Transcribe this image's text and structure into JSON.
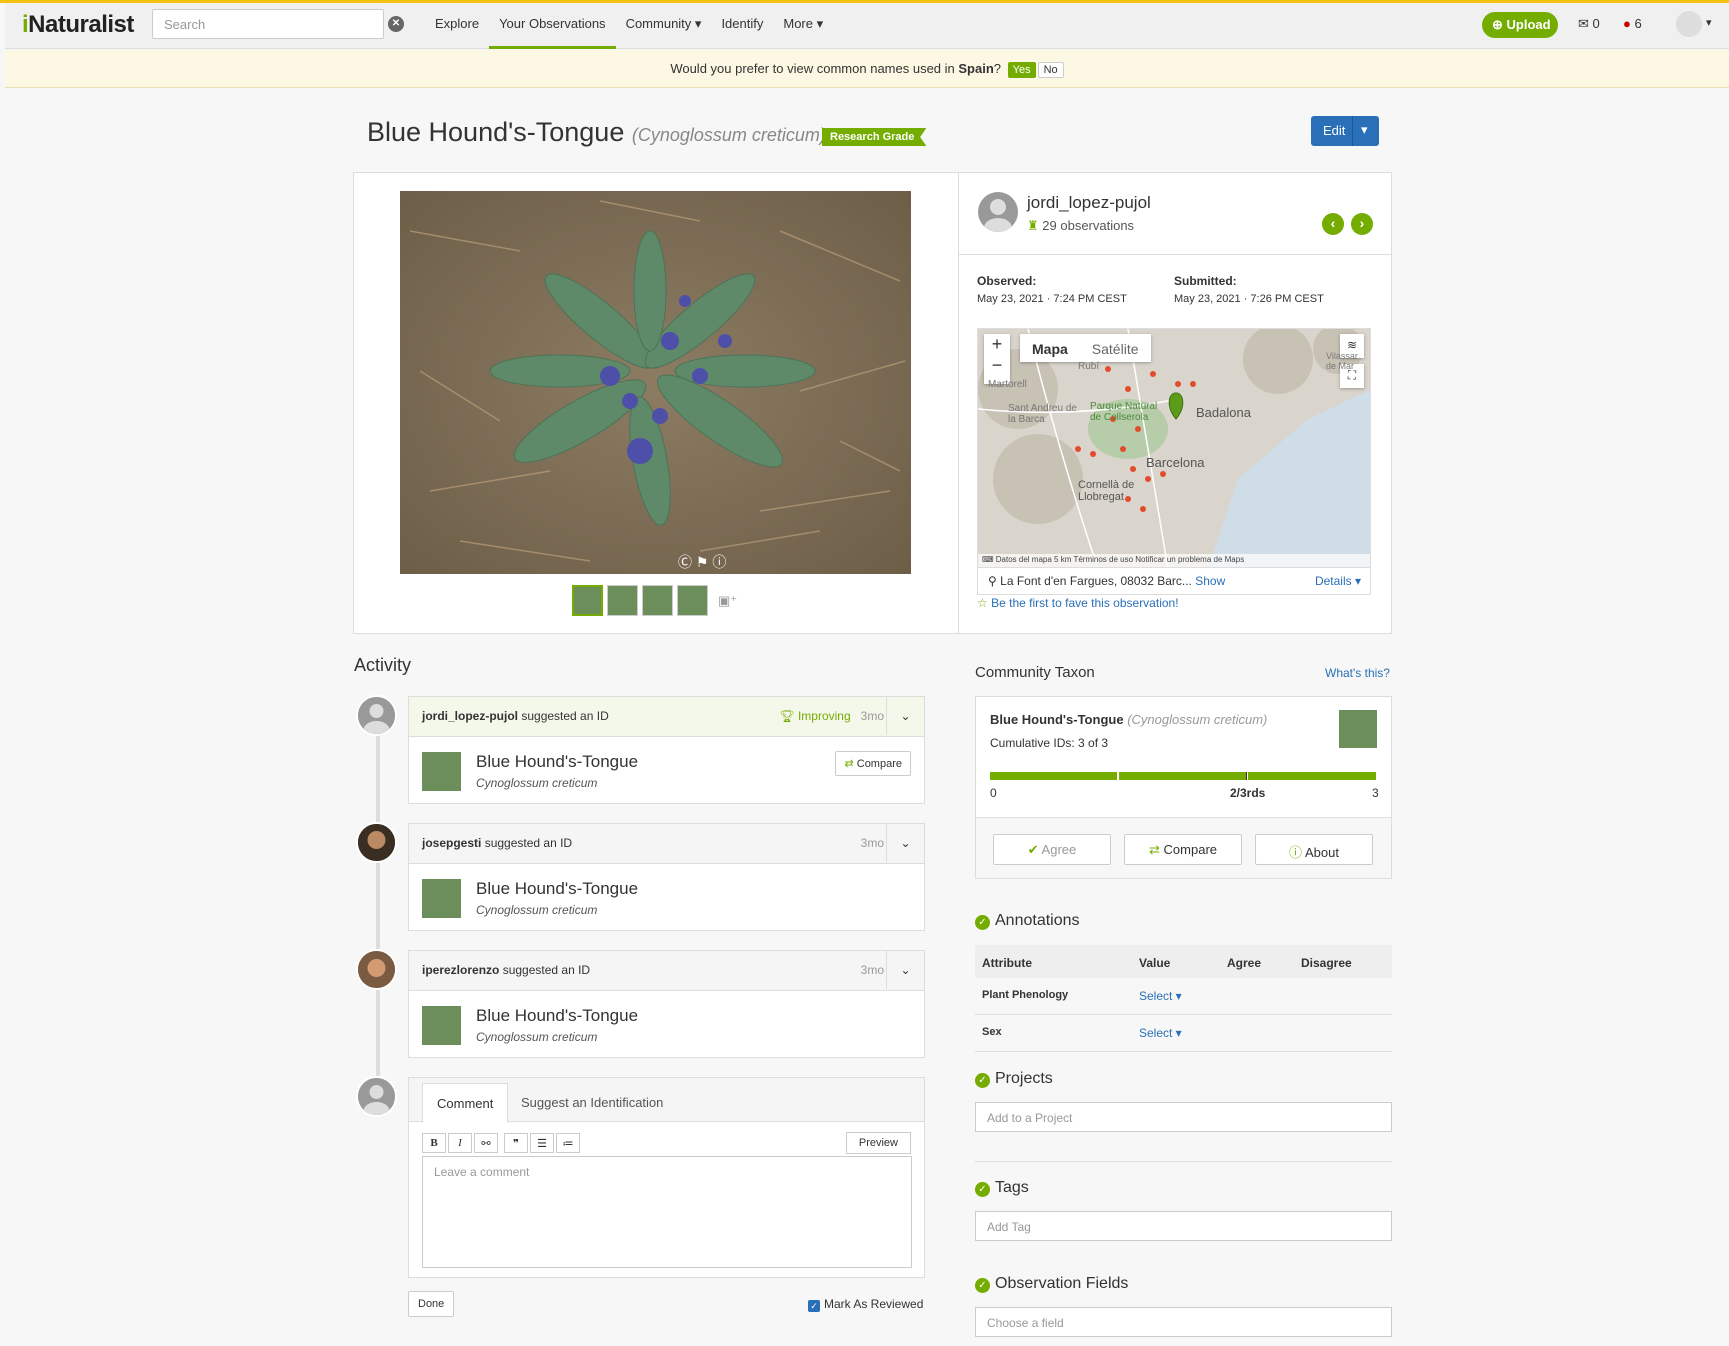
{
  "colors": {
    "brand": "#74ac00",
    "link": "#2a70b8",
    "banner_bg": "#fdf8e4"
  },
  "header": {
    "logo_prefix": "i",
    "logo_rest": "Naturalist",
    "search_placeholder": "Search",
    "nav": [
      {
        "label": "Explore",
        "active": false
      },
      {
        "label": "Your Observations",
        "active": true
      },
      {
        "label": "Community ▾",
        "active": false
      },
      {
        "label": "Identify",
        "active": false
      },
      {
        "label": "More ▾",
        "active": false
      }
    ],
    "upload_label": "Upload",
    "messages_count": "0",
    "notifications_count": "6"
  },
  "banner": {
    "text_before": "Would you prefer to view common names used in ",
    "place": "Spain",
    "text_after": "?",
    "yes": "Yes",
    "no": "No"
  },
  "observation": {
    "common_name": "Blue Hound's-Tongue",
    "sci_name": "Cynoglossum creticum",
    "quality_grade": "Research Grade",
    "edit_label": "Edit",
    "user": {
      "login": "jordi_lopez-pujol",
      "observations": "29 observations"
    },
    "observed_label": "Observed:",
    "observed_value": "May 23, 2021 · 7:24 PM CEST",
    "submitted_label": "Submitted:",
    "submitted_value": "May 23, 2021 · 7:26 PM CEST",
    "map": {
      "tab_map": "Mapa",
      "tab_sat": "Satélite",
      "cities": [
        "Badalona",
        "Barcelona",
        "Cornellà de Llobregat",
        "Sant Andreu de la Barca",
        "Parque Natural de Collserola",
        "Martorell",
        "Rubí",
        "Vilassar de Mar"
      ],
      "footer": "Datos del mapa   5 km        Términos de uso   Notificar un problema de Maps"
    },
    "place_guess": "La Font d'en Fargues, 08032 Barc...",
    "show_label": "Show",
    "details_label": "Details ▾",
    "fave_label": "Be the first to fave this observation!"
  },
  "activity": {
    "title": "Activity",
    "items": [
      {
        "user": "jordi_lopez-pujol",
        "action": "suggested an ID",
        "improving": "Improving",
        "time": "3mo",
        "common": "Blue Hound's-Tongue",
        "sci": "Cynoglossum creticum",
        "compare": "Compare"
      },
      {
        "user": "josepgesti",
        "action": "suggested an ID",
        "time": "3mo",
        "common": "Blue Hound's-Tongue",
        "sci": "Cynoglossum creticum"
      },
      {
        "user": "iperezlorenzo",
        "action": "suggested an ID",
        "time": "3mo",
        "common": "Blue Hound's-Tongue",
        "sci": "Cynoglossum creticum"
      }
    ],
    "comment_tab": "Comment",
    "suggest_tab": "Suggest an Identification",
    "toolbar": [
      "B",
      "I",
      "⚯",
      "❞",
      "☰",
      "≔"
    ],
    "preview": "Preview",
    "comment_placeholder": "Leave a comment",
    "done": "Done",
    "mark_reviewed": "Mark As Reviewed"
  },
  "community_taxon": {
    "title": "Community Taxon",
    "whats_this": "What's this?",
    "common": "Blue Hound's-Tongue",
    "sci": "Cynoglossum creticum",
    "cumulative": "Cumulative IDs: 3 of 3",
    "agreement_fraction": 1.0,
    "tick_min": "0",
    "tick_mid": "2/3rds",
    "tick_max": "3",
    "agree": "Agree",
    "compare": "Compare",
    "about": "About"
  },
  "annotations": {
    "title": "Annotations",
    "headers": [
      "Attribute",
      "Value",
      "Agree",
      "Disagree"
    ],
    "rows": [
      {
        "attribute": "Plant Phenology",
        "value": "Select ▾"
      },
      {
        "attribute": "Sex",
        "value": "Select ▾"
      }
    ]
  },
  "projects": {
    "title": "Projects",
    "placeholder": "Add to a Project"
  },
  "tags": {
    "title": "Tags",
    "placeholder": "Add Tag"
  },
  "obs_fields": {
    "title": "Observation Fields",
    "placeholder": "Choose a field"
  }
}
